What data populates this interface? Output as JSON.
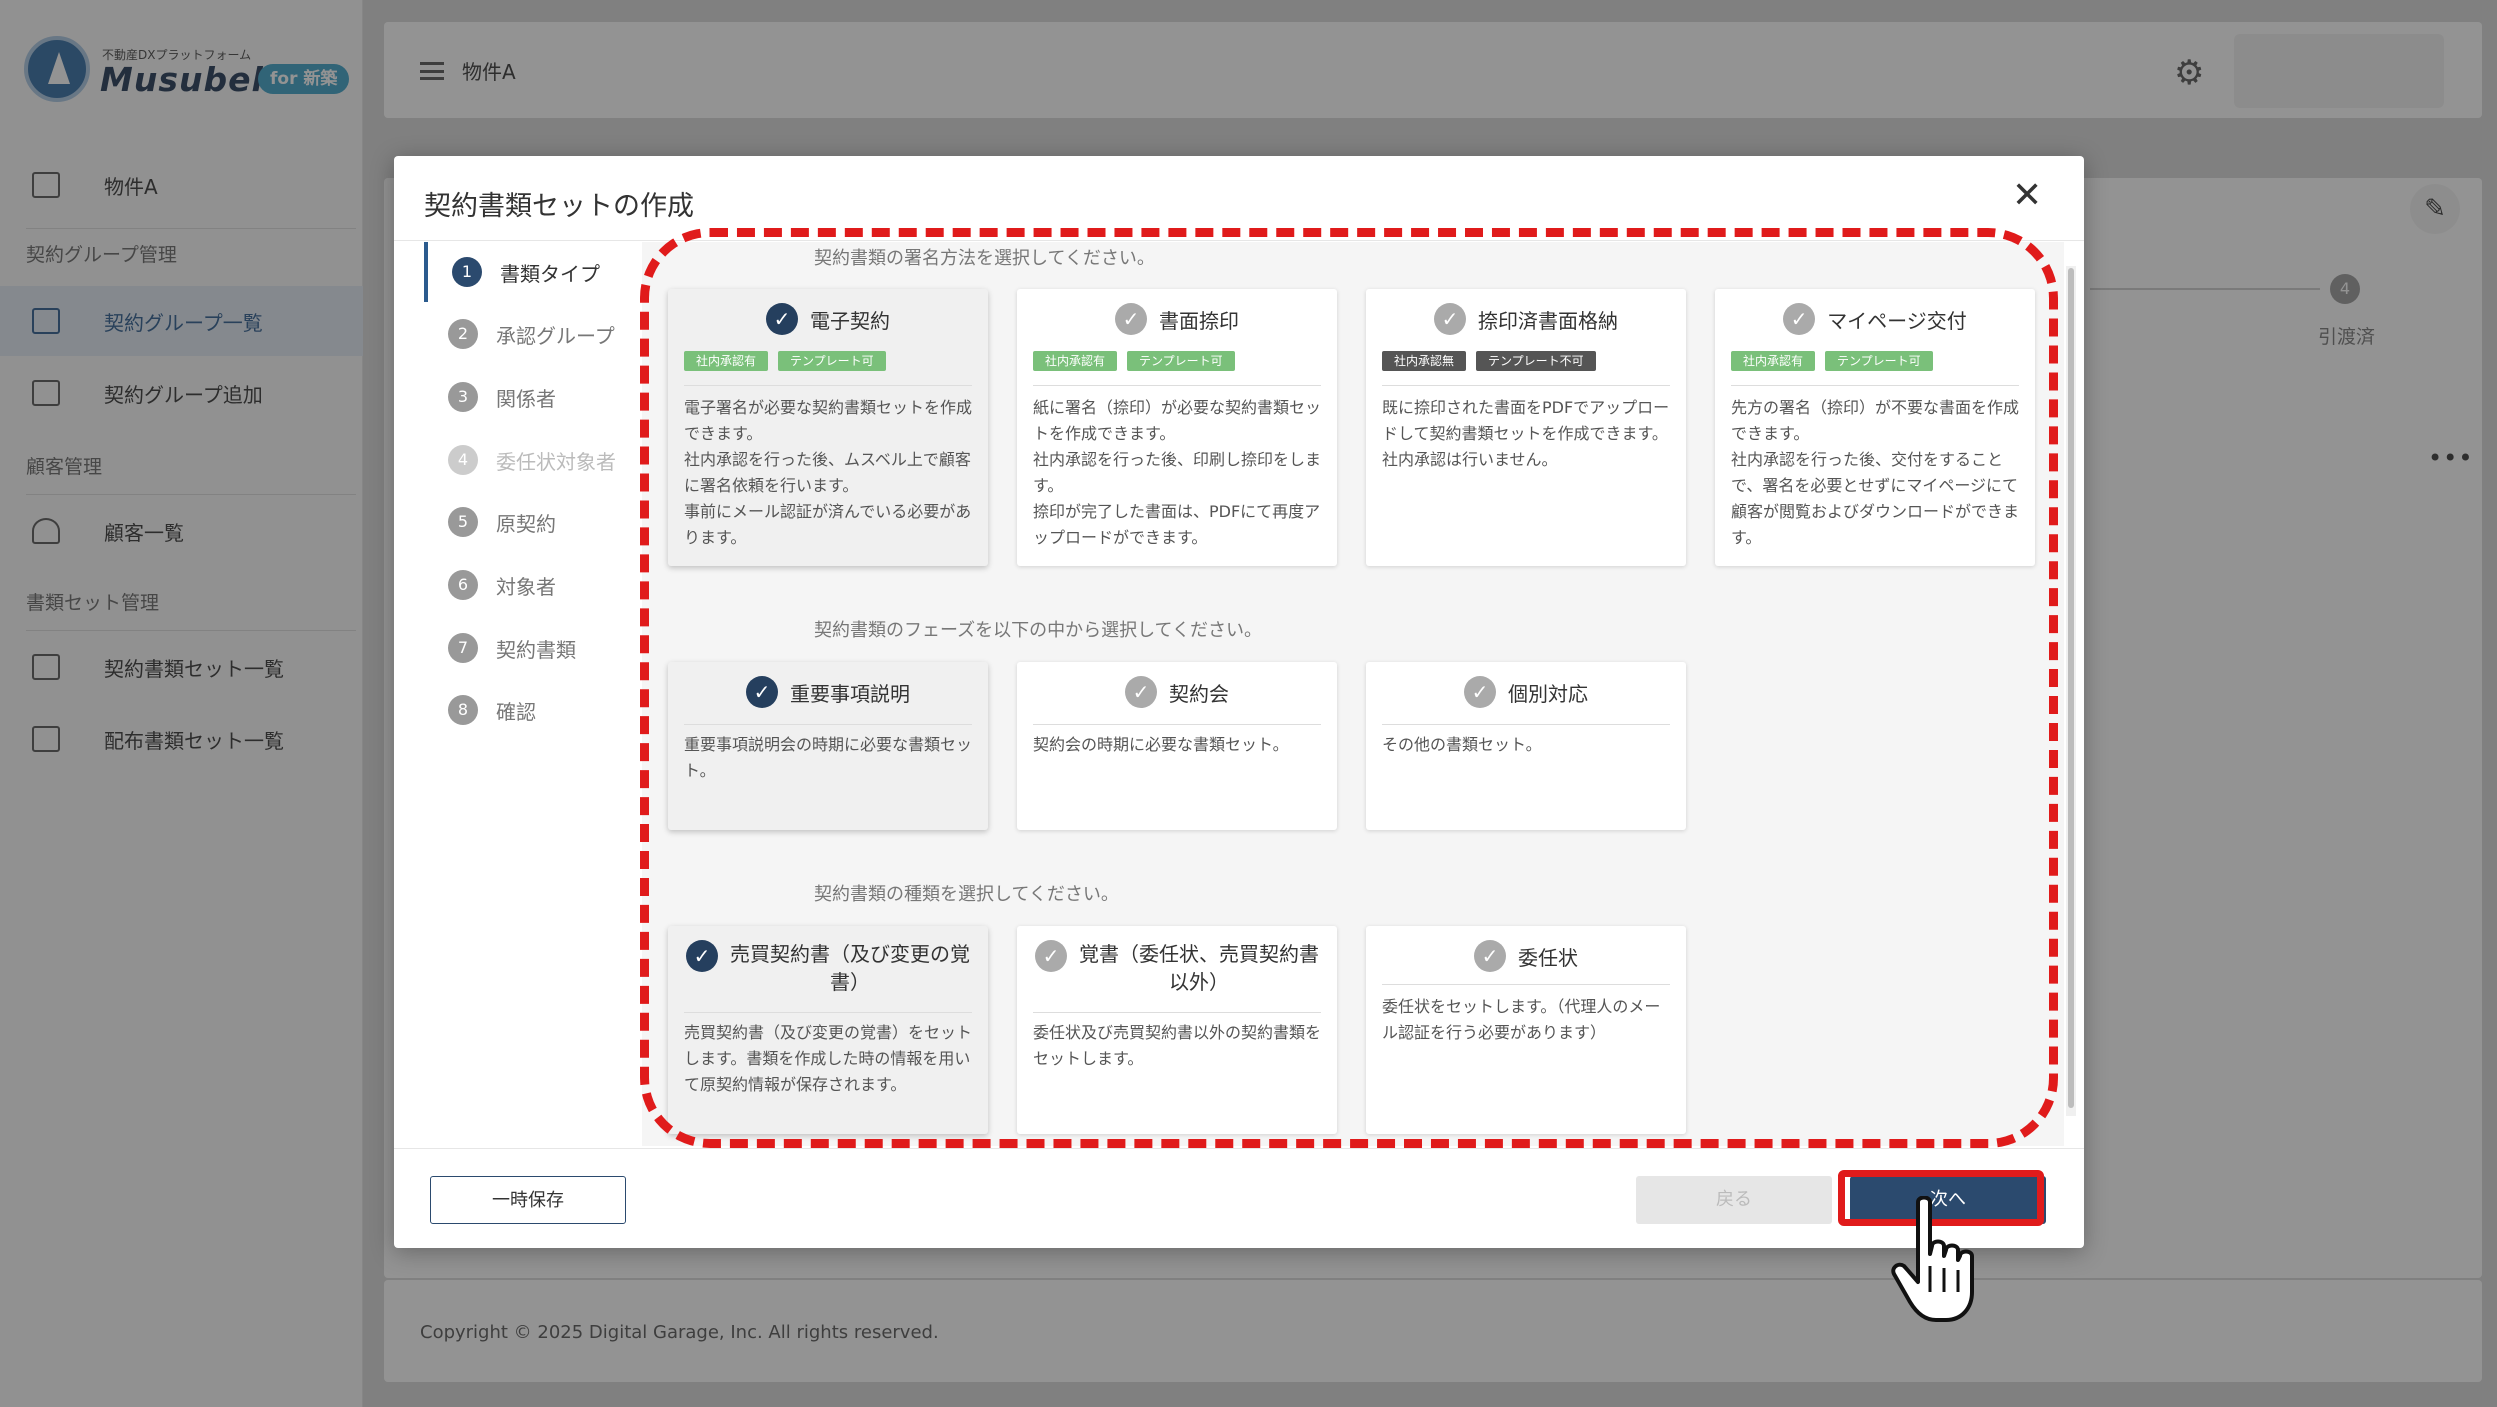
{
  "brand": {
    "subtitle": "不動産DXプラットフォーム",
    "name": "Musubell",
    "badge": "for 新築"
  },
  "sidebar": {
    "top_item": "物件A",
    "sections": [
      {
        "label": "契約グループ管理"
      },
      {
        "label": "顧客管理"
      },
      {
        "label": "書類セット管理"
      }
    ],
    "items": [
      {
        "label": "契約グループ一覧",
        "active": true
      },
      {
        "label": "契約グループ追加",
        "active": false
      },
      {
        "label": "顧客一覧",
        "active": false
      },
      {
        "label": "契約書類セット一覧",
        "active": false
      },
      {
        "label": "配布書類セット一覧",
        "active": false
      }
    ]
  },
  "topbar": {
    "title": "物件A",
    "settings_icon": "gear-icon"
  },
  "background": {
    "step4_num": "4",
    "step4_label": "引渡済",
    "more": "•••"
  },
  "footer": {
    "copyright": "Copyright © 2025 Digital Garage, Inc. All rights reserved."
  },
  "modal": {
    "title": "契約書類セットの作成",
    "close": "✕",
    "steps": [
      {
        "num": "1",
        "label": "書類タイプ",
        "state": "current"
      },
      {
        "num": "2",
        "label": "承認グループ",
        "state": "normal"
      },
      {
        "num": "3",
        "label": "関係者",
        "state": "normal"
      },
      {
        "num": "4",
        "label": "委任状対象者",
        "state": "disabled"
      },
      {
        "num": "5",
        "label": "原契約",
        "state": "normal"
      },
      {
        "num": "6",
        "label": "対象者",
        "state": "normal"
      },
      {
        "num": "7",
        "label": "契約書類",
        "state": "normal"
      },
      {
        "num": "8",
        "label": "確認",
        "state": "normal"
      }
    ],
    "sign_method": {
      "prompt": "契約書類の署名方法を選択してください。",
      "options": [
        {
          "title": "電子契約",
          "selected": true,
          "tags": [
            {
              "text": "社内承認有",
              "dark": false
            },
            {
              "text": "テンプレート可",
              "dark": false
            }
          ],
          "desc": "電子署名が必要な契約書類セットを作成できます。\n社内承認を行った後、ムスベル上で顧客に署名依頼を行います。\n事前にメール認証が済んでいる必要があります。"
        },
        {
          "title": "書面捺印",
          "selected": false,
          "tags": [
            {
              "text": "社内承認有",
              "dark": false
            },
            {
              "text": "テンプレート可",
              "dark": false
            }
          ],
          "desc": "紙に署名（捺印）が必要な契約書類セットを作成できます。\n社内承認を行った後、印刷し捺印をします。\n捺印が完了した書面は、PDFにて再度アップロードができます。"
        },
        {
          "title": "捺印済書面格納",
          "selected": false,
          "tags": [
            {
              "text": "社内承認無",
              "dark": true
            },
            {
              "text": "テンプレート不可",
              "dark": true
            }
          ],
          "desc": "既に捺印された書面をPDFでアップロードして契約書類セットを作成できます。\n社内承認は行いません。"
        },
        {
          "title": "マイページ交付",
          "selected": false,
          "tags": [
            {
              "text": "社内承認有",
              "dark": false
            },
            {
              "text": "テンプレート可",
              "dark": false
            }
          ],
          "desc": "先方の署名（捺印）が不要な書面を作成できます。\n社内承認を行った後、交付をすることで、署名を必要とせずにマイページにて顧客が閲覧およびダウンロードができます。"
        }
      ]
    },
    "phase": {
      "prompt": "契約書類のフェーズを以下の中から選択してください。",
      "options": [
        {
          "title": "重要事項説明",
          "selected": true,
          "desc": "重要事項説明会の時期に必要な書類セット。"
        },
        {
          "title": "契約会",
          "selected": false,
          "desc": "契約会の時期に必要な書類セット。"
        },
        {
          "title": "個別対応",
          "selected": false,
          "desc": "その他の書類セット。"
        }
      ]
    },
    "doc_type": {
      "prompt": "契約書類の種類を選択してください。",
      "options": [
        {
          "title": "売買契約書（及び変更の覚書）",
          "selected": true,
          "desc": "売買契約書（及び変更の覚書）をセットします。書類を作成した時の情報を用いて原契約情報が保存されます。"
        },
        {
          "title": "覚書（委任状、売買契約書以外）",
          "selected": false,
          "desc": "委任状及び売買契約書以外の契約書類をセットします。"
        },
        {
          "title": "委任状",
          "selected": false,
          "desc": "委任状をセットします。（代理人のメール認証を行う必要があります）"
        }
      ]
    },
    "buttons": {
      "save_temp": "一時保存",
      "back": "戻る",
      "next": "次へ"
    }
  },
  "colors": {
    "accent": "#2b4a6e",
    "annotation": "#e01b1b",
    "tag_green": "#7ac07a",
    "tag_dark": "#555555"
  }
}
